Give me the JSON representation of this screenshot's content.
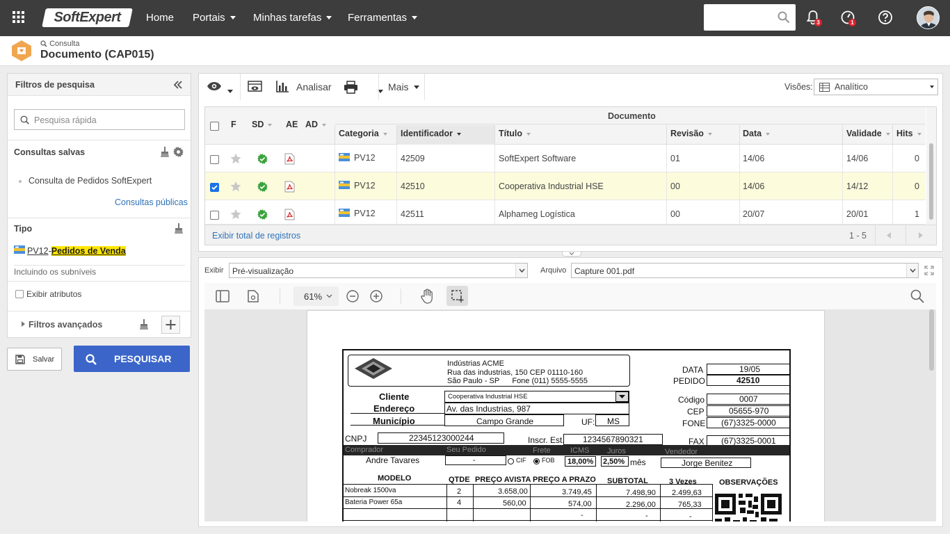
{
  "topbar": {
    "brand": "SoftExpert",
    "nav": [
      {
        "label": "Home"
      },
      {
        "label": "Portais"
      },
      {
        "label": "Minhas tarefas"
      },
      {
        "label": "Ferramentas"
      }
    ],
    "notifications_count": "3",
    "alerts_count": "1"
  },
  "header": {
    "breadcrumb": "Consulta",
    "title": "Documento (CAP015)"
  },
  "filters": {
    "title": "Filtros de pesquisa",
    "search_placeholder": "Pesquisa rápida",
    "saved_title": "Consultas salvas",
    "saved_items": [
      "Consulta de Pedidos SoftExpert"
    ],
    "public_link": "Consultas públicas",
    "tipo_title": "Tipo",
    "tipo_code": "PV12",
    "tipo_separator": "-",
    "tipo_name": "Pedidos de Venda",
    "subniveis": "Incluindo os subníveis",
    "exibir_atributos": "Exibir atributos",
    "advanced": "Filtros avançados",
    "save_label": "Salvar",
    "search_label": "PESQUISAR"
  },
  "toolbar": {
    "analisar": "Analisar",
    "mais": "Mais",
    "visoes_label": "Visões:",
    "visoes_value": "Analítico"
  },
  "grid": {
    "group_header": "Documento",
    "columns": [
      "F",
      "SD",
      "AE",
      "AD",
      "Categoria",
      "Identificador",
      "Título",
      "Revisão",
      "Data",
      "Validade",
      "Hits"
    ],
    "rows": [
      {
        "checked": false,
        "categoria": "PV12",
        "identificador": "42509",
        "titulo": "SoftExpert Software",
        "revisao": "01",
        "data": "14/06",
        "validade": "14/06",
        "hits": "0"
      },
      {
        "checked": true,
        "categoria": "PV12",
        "identificador": "42510",
        "titulo": "Cooperativa Industrial HSE",
        "revisao": "00",
        "data": "14/06",
        "validade": "14/12",
        "hits": "0"
      },
      {
        "checked": false,
        "categoria": "PV12",
        "identificador": "42511",
        "titulo": "Alphameg Logística",
        "revisao": "00",
        "data": "20/07",
        "validade": "20/01",
        "hits": "1"
      }
    ],
    "total_link": "Exibir total de registros",
    "pagination": "1 - 5"
  },
  "preview": {
    "exibir_label": "Exibir",
    "exibir_value": "Pré-visualização",
    "arquivo_label": "Arquivo",
    "arquivo_value": "Capture 001.pdf",
    "zoom": "61%"
  },
  "document": {
    "company": "Indústrias ACME",
    "address1": "Rua das industrias, 150 CEP 01110-160",
    "address2": "São Paulo - SP      Fone (011) 5555-5555",
    "data_label": "DATA",
    "data_value": "19/05",
    "pedido_label": "PEDIDO",
    "pedido_value": "42510",
    "cliente_label": "Cliente",
    "cliente_value": "Cooperativa Industrial HSE",
    "endereco_label": "Endereço",
    "endereco_value": "Av. das Industrias, 987",
    "municipio_label": "Município",
    "municipio_value": "Campo Grande",
    "uf_label": "UF:",
    "uf_value": "MS",
    "codigo_label": "Código",
    "codigo_value": "0007",
    "cep_label": "CEP",
    "cep_value": "05655-970",
    "fone_label": "FONE",
    "fone_value": "(67)3325-0000",
    "cnpj_label": "CNPJ",
    "cnpj_value": "22345123000244",
    "inscr_label": "Inscr. Est.",
    "inscr_value": "1234567890321",
    "fax_label": "FAX",
    "fax_value": "(67)3325-0001",
    "comprador_label": "Comprador",
    "seu_pedido_label": "Seu Pedido",
    "frete_label": "Frete",
    "icms_label": "ICMS",
    "juros_label": "Juros",
    "vendedor_label": "Vendedor",
    "comprador_value": "Andre Tavares",
    "seu_pedido_value": "-",
    "cif": "CIF",
    "fob": "FOB",
    "icms_value": "18,00%",
    "juros_value": "2,50%",
    "mes": "mês",
    "vendedor_value": "Jorge Benitez",
    "items_headers": [
      "MODELO",
      "QTDE",
      "PREÇO AVISTA",
      "PREÇO A PRAZO",
      "SUBTOTAL",
      "3 Vezes",
      "OBSERVAÇÕES"
    ],
    "items": [
      {
        "modelo": "Nobreak 1500va",
        "qtde": "2",
        "avista": "3.658,00",
        "prazo": "3.749,45",
        "subtotal": "7.498,90",
        "vezes": "2.499,63"
      },
      {
        "modelo": "Bateria Power 65a",
        "qtde": "4",
        "avista": "560,00",
        "prazo": "574,00",
        "subtotal": "2.296,00",
        "vezes": "765,33"
      },
      {
        "modelo": "",
        "qtde": "",
        "avista": "",
        "prazo": "-",
        "subtotal": "-",
        "vezes": "-"
      }
    ]
  }
}
